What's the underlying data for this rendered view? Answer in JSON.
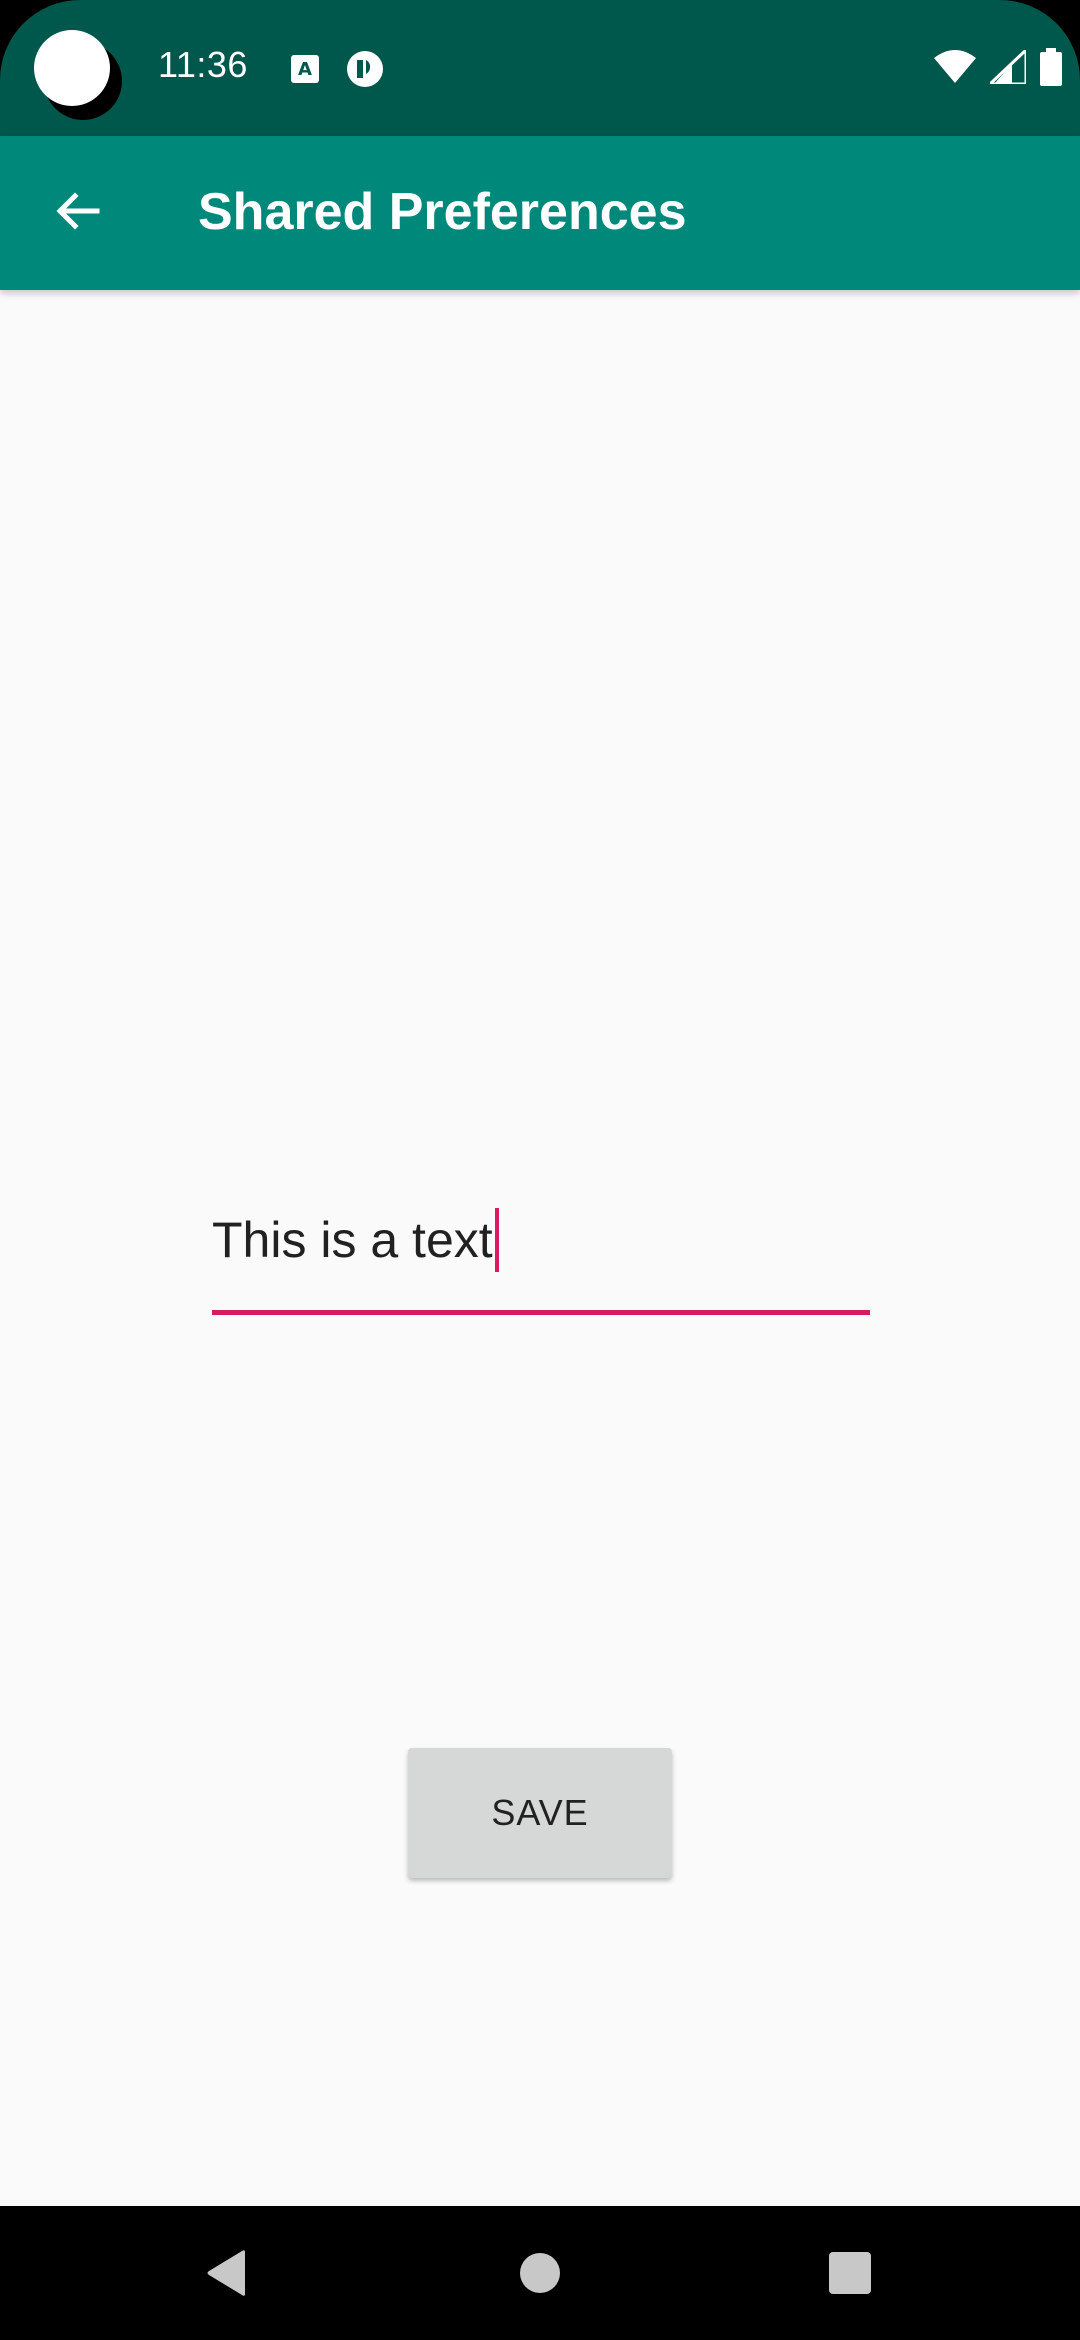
{
  "status_bar": {
    "time": "11:36",
    "background": "#00574B",
    "icons": [
      "notification-a-icon",
      "notification-circle-icon",
      "wifi-icon",
      "signal-icon",
      "battery-icon"
    ]
  },
  "app_bar": {
    "title": "Shared Preferences",
    "background": "#00897B",
    "back_icon": "arrow-back-icon"
  },
  "form": {
    "text_value": "This is a text",
    "accent_color": "#D81B60",
    "save_label": "SAVE"
  },
  "nav_bar": {
    "icons": [
      "back-triangle-icon",
      "home-circle-icon",
      "recents-square-icon"
    ]
  }
}
